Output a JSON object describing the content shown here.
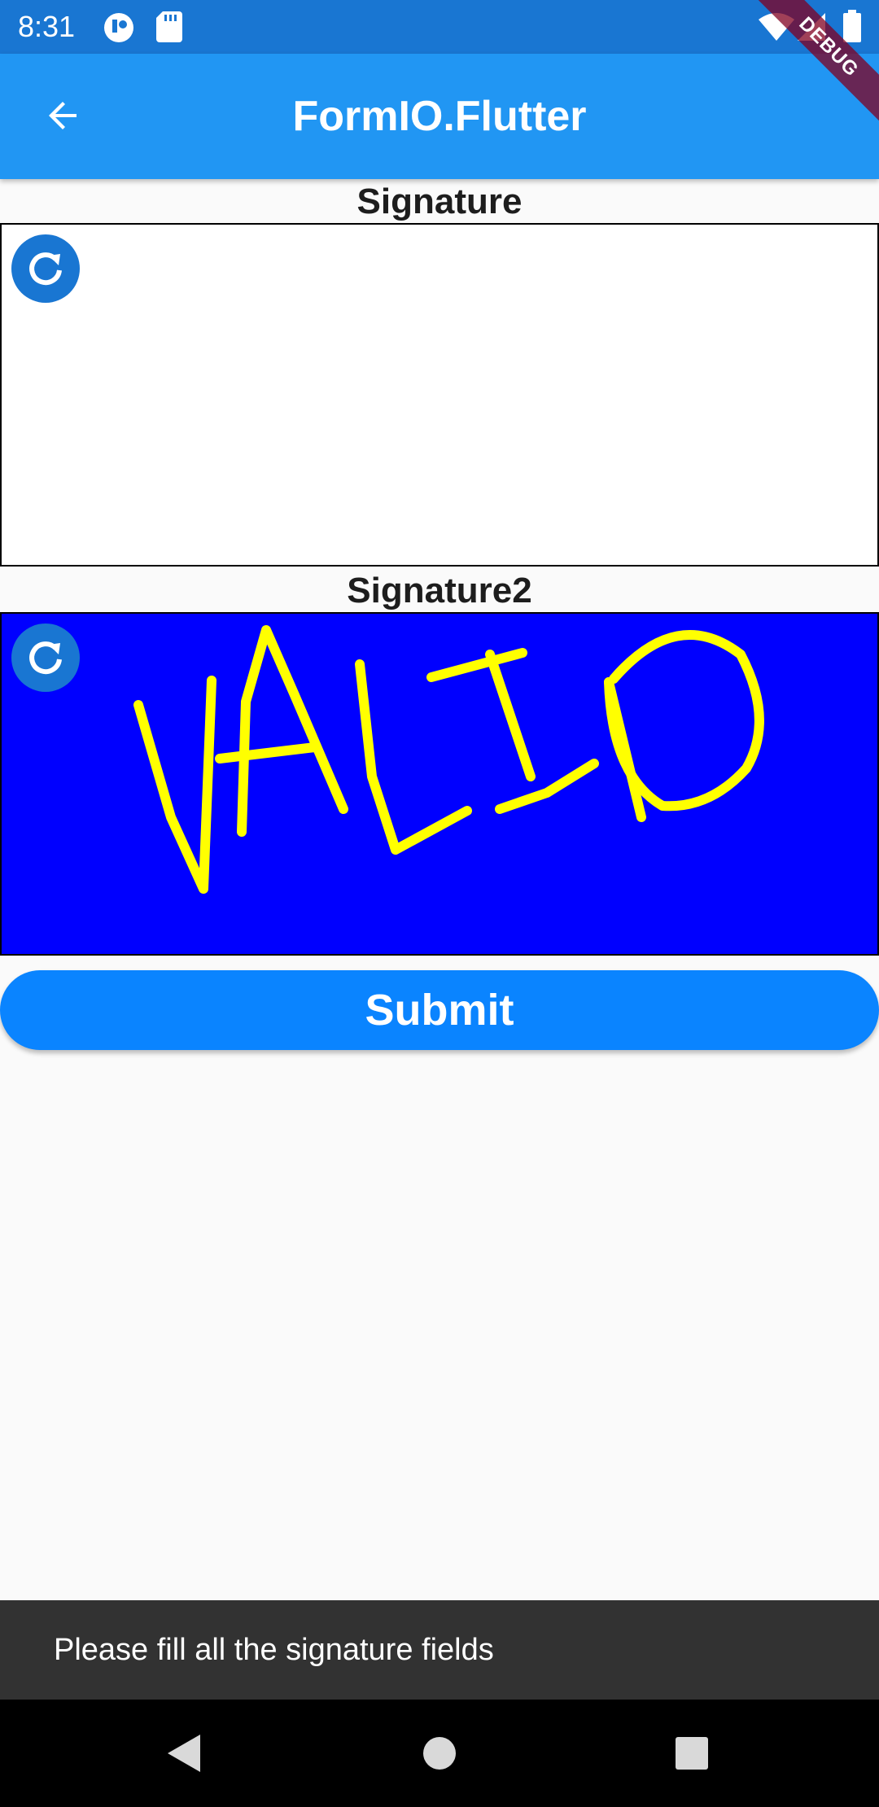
{
  "status_bar": {
    "time": "8:31",
    "icons": [
      "app-notification-icon",
      "sd-card-icon",
      "wifi-icon",
      "signal-icon",
      "battery-icon"
    ]
  },
  "app_bar": {
    "title": "FormIO.Flutter",
    "back_icon": "arrow-back-icon",
    "debug_banner": "DEBUG"
  },
  "form": {
    "signature1": {
      "label": "Signature",
      "reset_icon": "refresh-icon",
      "background": "#ffffff"
    },
    "signature2": {
      "label": "Signature2",
      "reset_icon": "refresh-icon",
      "background": "#0000ff",
      "stroke_color": "#ffff00",
      "drawn_text": "VALID"
    },
    "submit_label": "Submit"
  },
  "snackbar": {
    "message": "Please fill all the signature fields"
  },
  "nav": {
    "back_icon": "nav-back-icon",
    "home_icon": "nav-home-icon",
    "recents_icon": "nav-recents-icon"
  },
  "colors": {
    "status_bar": "#1976d2",
    "app_bar": "#2196f3",
    "submit": "#0a84ff",
    "snackbar": "#323232"
  }
}
